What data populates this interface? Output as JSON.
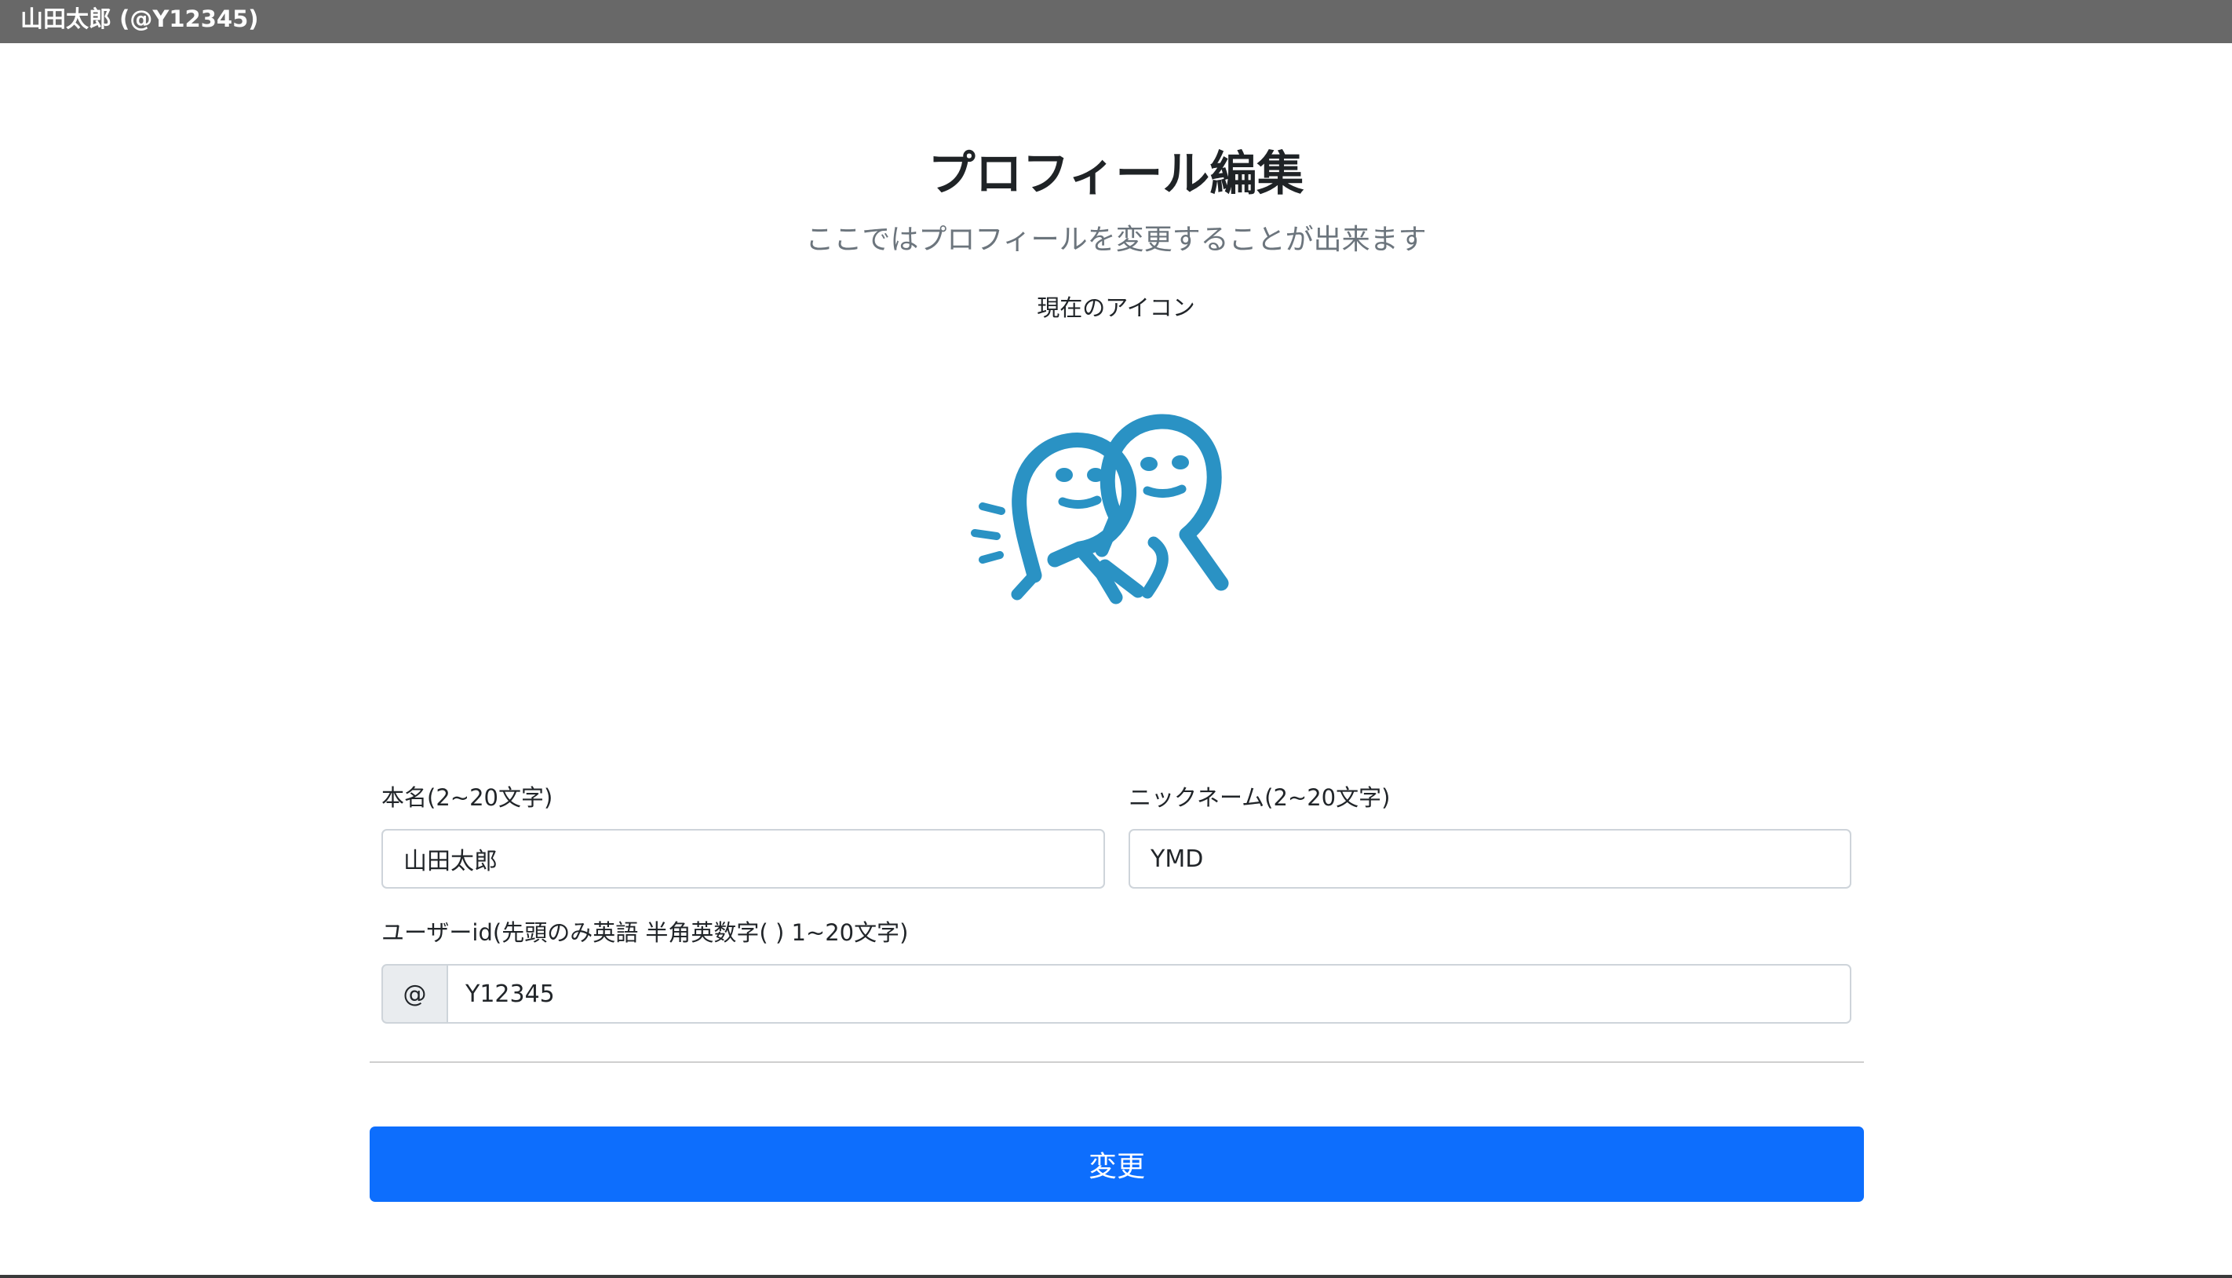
{
  "header": {
    "user_label": "山田太郎 (@Y12345)"
  },
  "page": {
    "title": "プロフィール編集",
    "subtitle": "ここではプロフィールを変更することが出来ます",
    "icon_caption": "現在のアイコン",
    "avatar_icon": "two-smiling-figures-icon",
    "avatar_color": "#2a92c4"
  },
  "form": {
    "real_name": {
      "label": "本名(2~20文字)",
      "value": "山田太郎"
    },
    "nickname": {
      "label": "ニックネーム(2~20文字)",
      "value": "YMD"
    },
    "user_id": {
      "label": "ユーザーid(先頭のみ英語 半角英数字( ) 1~20文字)",
      "prefix": "@",
      "value": "Y12345"
    },
    "submit_label": "変更"
  },
  "colors": {
    "topbar": "#686868",
    "primary": "#0d6efd",
    "input_border": "#ced4da",
    "prefix_background": "#e9ecef"
  }
}
